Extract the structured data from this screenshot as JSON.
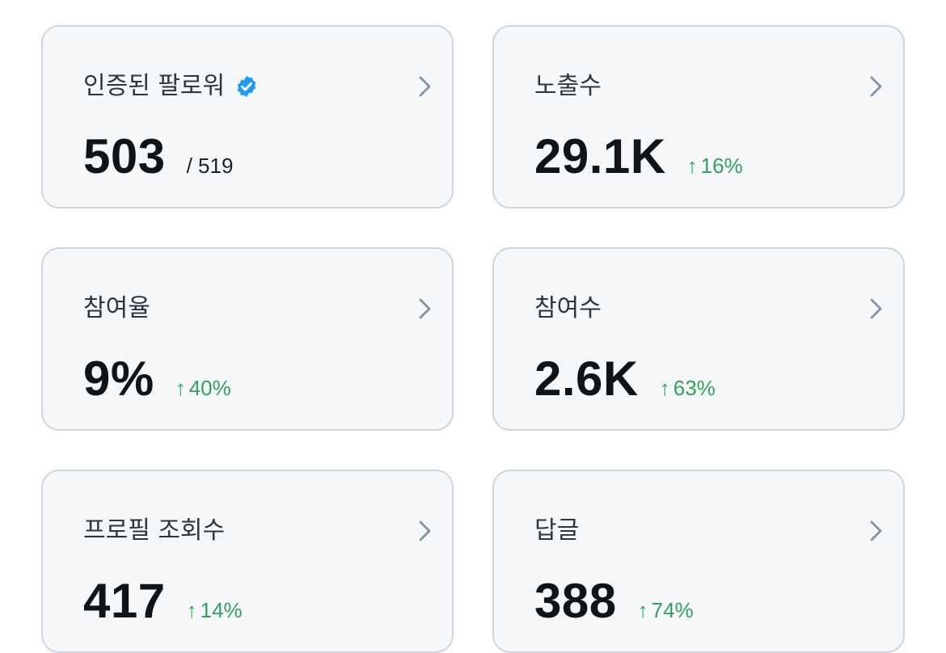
{
  "colors": {
    "card_background": "#f5f7f8",
    "card_border": "#cdd6de",
    "value_text": "#0f1419",
    "positive_change": "#35a05e",
    "verified_badge": "#1d9bf0",
    "chevron": "#8095a8"
  },
  "cards": [
    {
      "title": "인증된 팔로워",
      "value": "503",
      "sub": "/ 519",
      "verified_icon": "verified-badge-icon",
      "chevron_icon": "chevron-right-icon"
    },
    {
      "title": "노출수",
      "value": "29.1K",
      "change": "16%",
      "change_icon": "arrow-up-icon",
      "chevron_icon": "chevron-right-icon"
    },
    {
      "title": "참여율",
      "value": "9%",
      "change": "40%",
      "change_icon": "arrow-up-icon",
      "chevron_icon": "chevron-right-icon"
    },
    {
      "title": "참여수",
      "value": "2.6K",
      "change": "63%",
      "change_icon": "arrow-up-icon",
      "chevron_icon": "chevron-right-icon"
    },
    {
      "title": "프로필 조회수",
      "value": "417",
      "change": "14%",
      "change_icon": "arrow-up-icon",
      "chevron_icon": "chevron-right-icon"
    },
    {
      "title": "답글",
      "value": "388",
      "change": "74%",
      "change_icon": "arrow-up-icon",
      "chevron_icon": "chevron-right-icon"
    }
  ]
}
